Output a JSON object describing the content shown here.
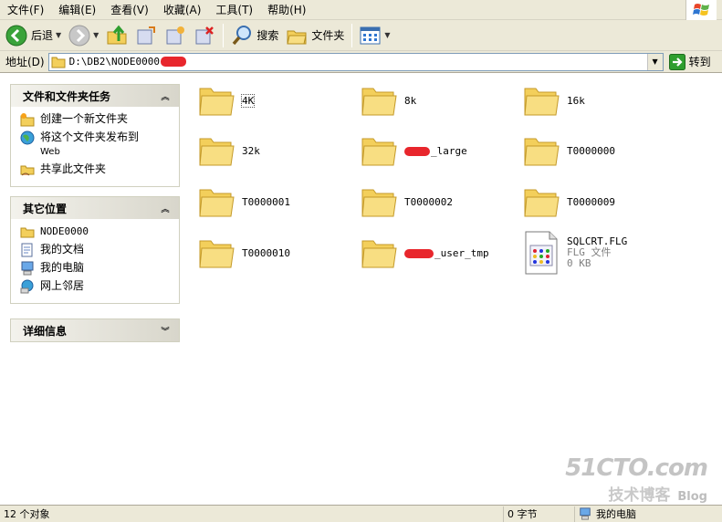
{
  "menu": [
    "文件(F)",
    "编辑(E)",
    "查看(V)",
    "收藏(A)",
    "工具(T)",
    "帮助(H)"
  ],
  "toolbar": {
    "back_label": "后退",
    "search_label": "搜索",
    "folders_label": "文件夹"
  },
  "address": {
    "label": "地址(D)",
    "path": "D:\\DB2\\NODE0000",
    "go_label": "转到"
  },
  "panels": {
    "tasks": {
      "title": "文件和文件夹任务",
      "items": [
        {
          "label": "创建一个新文件夹",
          "icon": "new-folder-icon"
        },
        {
          "label": "将这个文件夹发布到",
          "sub": "Web",
          "icon": "publish-web-icon"
        },
        {
          "label": "共享此文件夹",
          "icon": "share-folder-icon"
        }
      ]
    },
    "places": {
      "title": "其它位置",
      "items": [
        {
          "label": "NODE0000",
          "icon": "folder-icon"
        },
        {
          "label": "我的文档",
          "icon": "my-documents-icon"
        },
        {
          "label": "我的电脑",
          "icon": "my-computer-icon"
        },
        {
          "label": "网上邻居",
          "icon": "network-places-icon"
        }
      ]
    },
    "details": {
      "title": "详细信息"
    }
  },
  "items": [
    {
      "name": "4K",
      "type": "folder"
    },
    {
      "name": "8k",
      "type": "folder"
    },
    {
      "name": "16k",
      "type": "folder"
    },
    {
      "name": "32k",
      "type": "folder"
    },
    {
      "name": "_large",
      "type": "folder",
      "redacted": true
    },
    {
      "name": "T0000000",
      "type": "folder"
    },
    {
      "name": "T0000001",
      "type": "folder"
    },
    {
      "name": "T0000002",
      "type": "folder"
    },
    {
      "name": "T0000009",
      "type": "folder"
    },
    {
      "name": "T0000010",
      "type": "folder"
    },
    {
      "name": "_user_tmp",
      "type": "folder",
      "redacted": true
    },
    {
      "name": "SQLCRT.FLG",
      "type": "file",
      "filetype": "FLG 文件",
      "size": "0 KB"
    }
  ],
  "status": {
    "count": "12 个对象",
    "size": "0 字节",
    "location": "我的电脑"
  },
  "watermark": {
    "main": "51CTO.com",
    "sub": "技术博客",
    "blog": "Blog"
  },
  "colors": {
    "chrome": "#ece9d8",
    "folder": "#f7d56a",
    "go_green": "#2f9e2f",
    "redaction": "#e8262c"
  }
}
